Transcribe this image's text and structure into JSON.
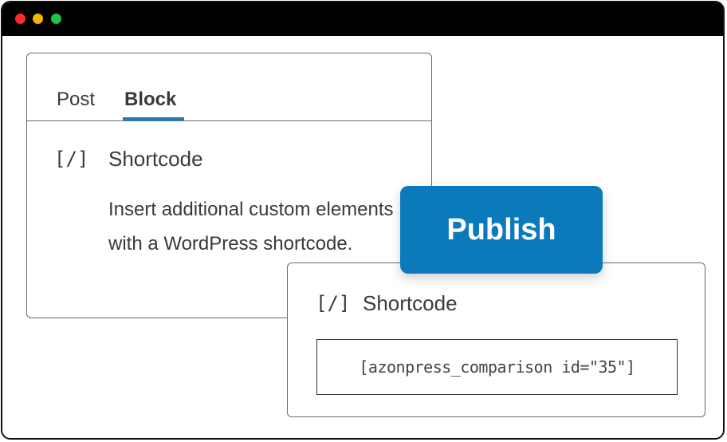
{
  "window": {
    "controls": [
      "close",
      "minimize",
      "maximize"
    ]
  },
  "sidebar_panel": {
    "tabs": [
      {
        "label": "Post",
        "active": false
      },
      {
        "label": "Block",
        "active": true
      }
    ],
    "block": {
      "icon_text": "[/]",
      "title": "Shortcode",
      "description": "Insert additional custom elements with a WordPress shortcode."
    }
  },
  "editor_block": {
    "icon_text": "[/]",
    "title": "Shortcode",
    "shortcode_value": "[azonpress_comparison id=\"35\"]"
  },
  "publish": {
    "label": "Publish"
  },
  "colors": {
    "accent": "#0b7abb",
    "tab_underline": "#1a7fb8",
    "titlebar": "#000000",
    "close_dot": "#ff2a2a",
    "minimize_dot": "#f7b500",
    "maximize_dot": "#1fc24a"
  }
}
